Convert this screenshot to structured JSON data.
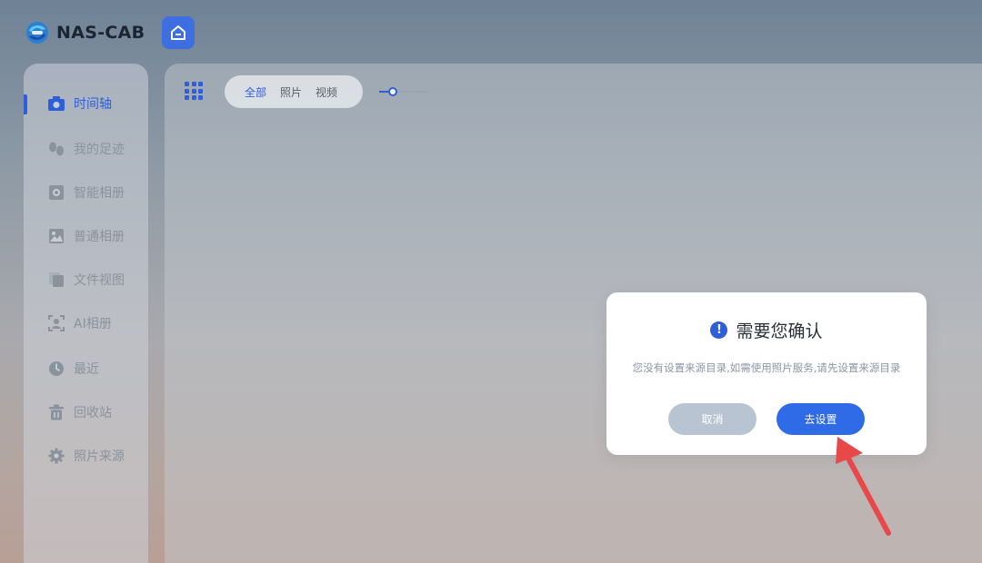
{
  "app": {
    "name": "NAS-CAB"
  },
  "sidebar": {
    "items": [
      {
        "label": "时间轴",
        "icon": "camera-icon",
        "active": true
      },
      {
        "label": "我的足迹",
        "icon": "footprint-icon",
        "active": false
      },
      {
        "label": "智能相册",
        "icon": "smart-album-icon",
        "active": false
      },
      {
        "label": "普通相册",
        "icon": "image-icon",
        "active": false
      },
      {
        "label": "文件视图",
        "icon": "files-icon",
        "active": false
      },
      {
        "label": "AI相册",
        "icon": "ai-face-icon",
        "active": false
      },
      {
        "label": "最近",
        "icon": "clock-icon",
        "active": false
      },
      {
        "label": "回收站",
        "icon": "trash-icon",
        "active": false
      },
      {
        "label": "照片来源",
        "icon": "gear-icon",
        "active": false
      }
    ]
  },
  "toolbar": {
    "filters": [
      {
        "label": "全部",
        "selected": true
      },
      {
        "label": "照片",
        "selected": false
      },
      {
        "label": "视频",
        "selected": false
      }
    ],
    "zoom_level": 0.28
  },
  "dialog": {
    "title": "需要您确认",
    "message": "您没有设置来源目录,如需使用照片服务,请先设置来源目录",
    "cancel_label": "取消",
    "confirm_label": "去设置"
  },
  "colors": {
    "accent": "#2f5fd8",
    "confirm_button": "#2f6be6",
    "cancel_button": "#b9c4d3",
    "arrow": "#e8484a"
  }
}
